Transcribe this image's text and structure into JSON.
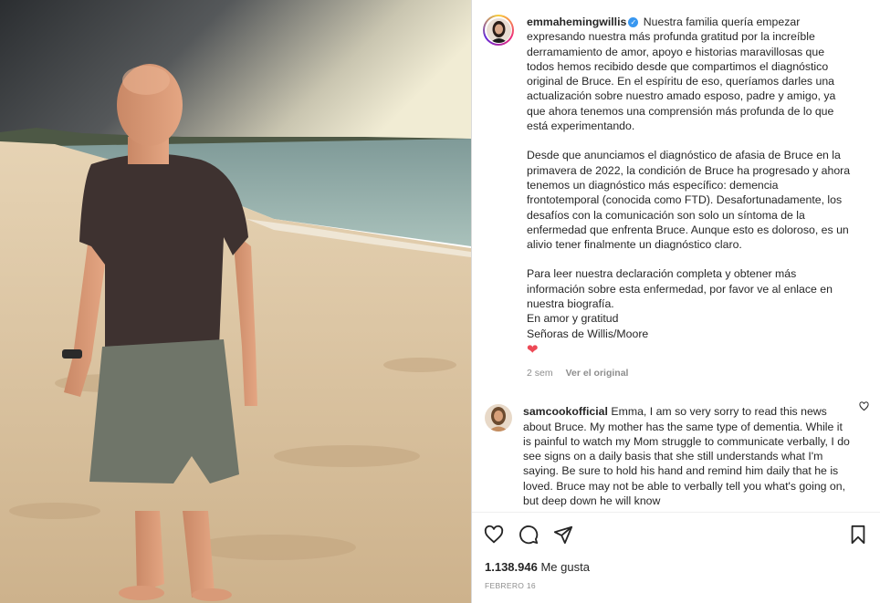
{
  "post": {
    "username": "emmahemingwillis",
    "verified_symbol": "✓",
    "paragraphs": [
      "Nuestra familia quería empezar expresando nuestra más profunda gratitud por la increíble derramamiento de amor, apoyo e historias maravillosas que todos hemos recibido desde que compartimos el diagnóstico original de Bruce. En el espíritu de eso, queríamos darles una actualización sobre nuestro amado esposo, padre y amigo, ya que ahora tenemos una comprensión más profunda de lo que está experimentando.",
      "Desde que anunciamos el diagnóstico de afasia de Bruce en la primavera de 2022, la condición de Bruce ha progresado y ahora tenemos un diagnóstico más específico: demencia frontotemporal (conocida como FTD). Desafortunadamente, los desafíos con la comunicación son solo un síntoma de la enfermedad que enfrenta Bruce. Aunque esto es doloroso, es un alivio tener finalmente un diagnóstico claro.",
      "Para leer nuestra declaración completa y obtener más información sobre esta enfermedad, por favor ve al enlace en nuestra biografía."
    ],
    "signoff_1": "En amor y gratitud",
    "signoff_2": "Señoras de Willis/Moore",
    "heart_glyph": "❤",
    "time_ago": "2 sem",
    "view_original": "Ver el original"
  },
  "comment": {
    "username": "samcookofficial",
    "text": "Emma, I am so very sorry to read this news about Bruce. My mother has the same type of dementia. While it is painful to watch my Mom struggle to communicate verbally, I do see signs on a daily basis that she still understands what I'm saying. Be sure to hold his hand and remind him daily that he is loved. Bruce may not be able to verbally tell you what's going on, but deep down he will know"
  },
  "stats": {
    "likes_count": "1.138.946",
    "likes_label": "Me gusta",
    "date": "FEBRERO 16"
  },
  "icons": {
    "like": "heart-outline-icon",
    "comment": "comment-bubble-icon",
    "share": "paper-plane-icon",
    "save": "bookmark-icon",
    "comment_like": "small-heart-icon"
  },
  "colors": {
    "verified": "#3897f0",
    "heart": "#ed4956",
    "muted": "#8e8e8e"
  }
}
